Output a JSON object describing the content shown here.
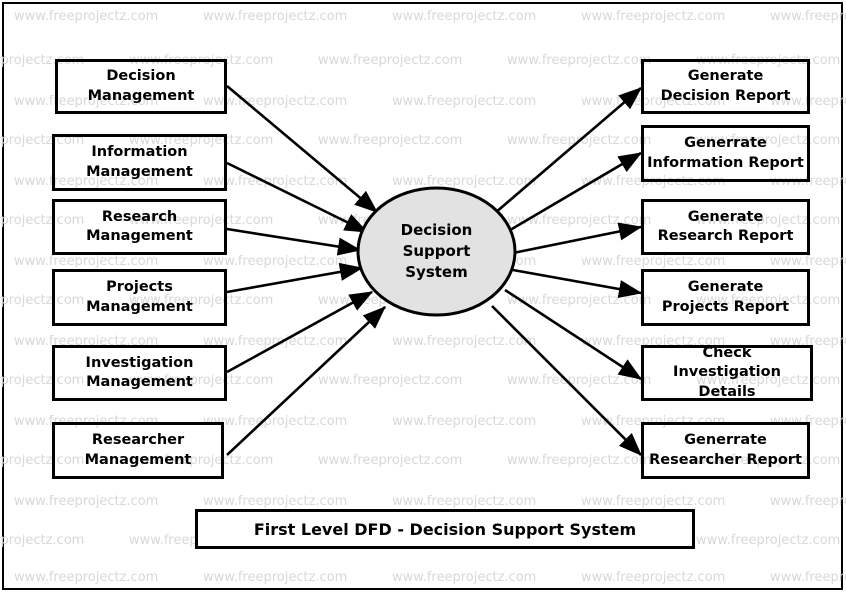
{
  "diagram": {
    "title": "First Level DFD - Decision Support System",
    "type": "data-flow-diagram",
    "process": {
      "label": "Decision\nSupport\nSystem",
      "shape": "ellipse",
      "fill": "#e2e2e2",
      "stroke": "#000000"
    },
    "inputs": [
      {
        "label": "Decision\nManagement"
      },
      {
        "label": "Information\nManagement"
      },
      {
        "label": "Research\nManagement"
      },
      {
        "label": "Projects\nManagement"
      },
      {
        "label": "Investigation\nManagement"
      },
      {
        "label": "Researcher\nManagement"
      }
    ],
    "outputs": [
      {
        "label": "Generate\nDecision Report"
      },
      {
        "label": "Generrate\nInformation Report"
      },
      {
        "label": "Generate\nResearch Report"
      },
      {
        "label": "Generate\nProjects Report"
      },
      {
        "label": "Check\nInvestigation Details"
      },
      {
        "label": "Generrate\nResearcher Report"
      }
    ]
  },
  "watermark": {
    "text": "www.freeprojectz.com",
    "color": "#d8d8d8"
  }
}
